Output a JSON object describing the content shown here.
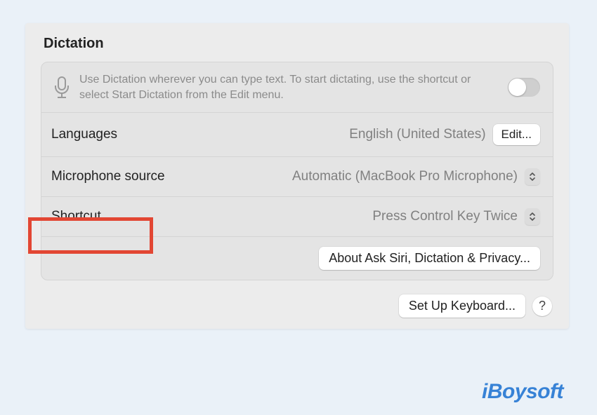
{
  "section": {
    "title": "Dictation",
    "info_text": "Use Dictation wherever you can type text. To start dictating, use the shortcut or select Start Dictation from the Edit menu.",
    "toggle_on": false
  },
  "languages": {
    "label": "Languages",
    "value": "English (United States)",
    "edit_label": "Edit..."
  },
  "microphone": {
    "label": "Microphone source",
    "value": "Automatic (MacBook Pro Microphone)"
  },
  "shortcut": {
    "label": "Shortcut",
    "value": "Press Control Key Twice"
  },
  "about": {
    "label": "About Ask Siri, Dictation & Privacy..."
  },
  "bottom": {
    "setup_label": "Set Up Keyboard...",
    "help_label": "?"
  },
  "watermark": "iBoysoft"
}
